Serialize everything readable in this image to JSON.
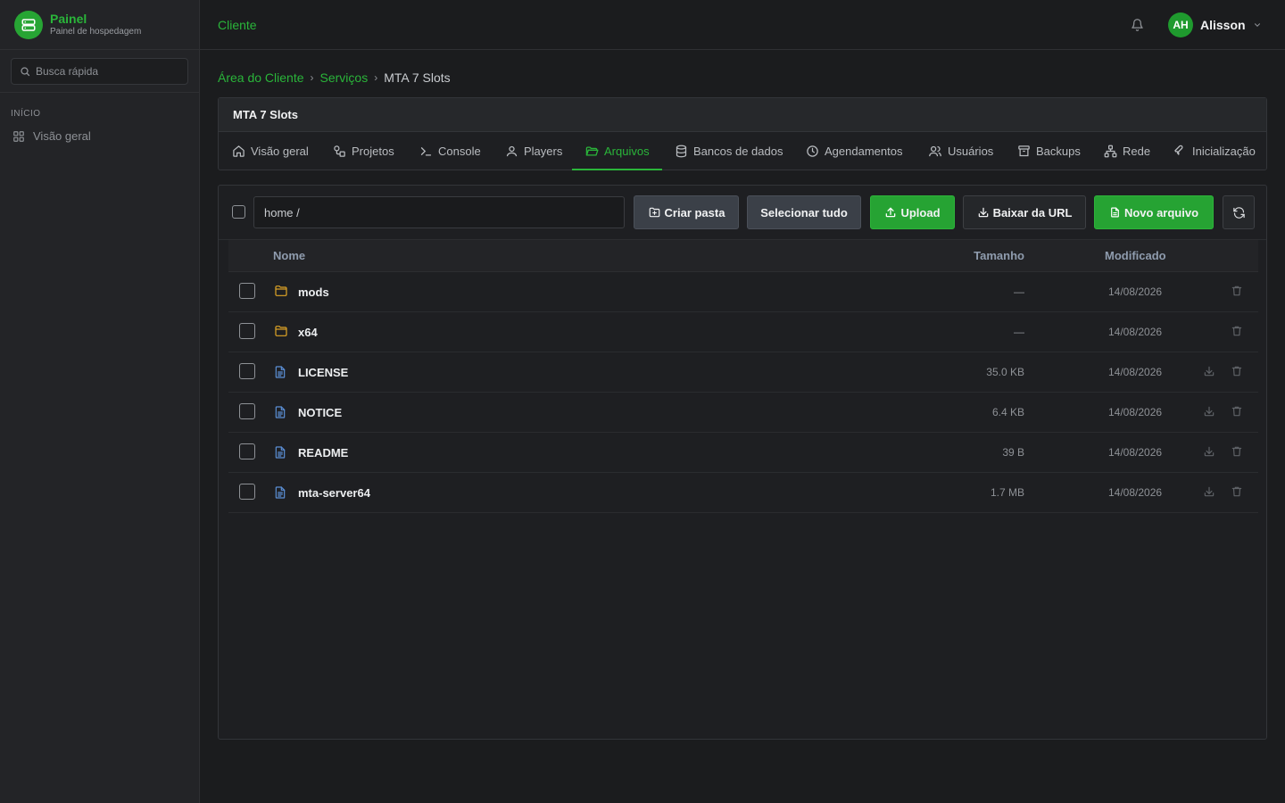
{
  "brand": {
    "title": "Painel",
    "subtitle": "Painel de hospedagem"
  },
  "sidebar": {
    "search_placeholder": "Busca rápida",
    "section_label": "INÍCIO",
    "items": [
      {
        "label": "Visão geral",
        "icon": "grid-icon"
      }
    ]
  },
  "header": {
    "title": "Cliente",
    "user": {
      "initials": "AH",
      "name": "Alisson"
    }
  },
  "breadcrumb": [
    {
      "label": "Área do Cliente"
    },
    {
      "label": "Serviços"
    },
    {
      "label": "MTA 7 Slots"
    }
  ],
  "service": {
    "title": "MTA 7 Slots",
    "tabs": [
      {
        "label": "Visão geral",
        "icon": "home-icon"
      },
      {
        "label": "Projetos",
        "icon": "projects-icon"
      },
      {
        "label": "Console",
        "icon": "terminal-icon"
      },
      {
        "label": "Players",
        "icon": "user-icon"
      },
      {
        "label": "Arquivos",
        "icon": "folder-open-icon",
        "active": true
      },
      {
        "label": "Bancos de dados",
        "icon": "database-icon"
      },
      {
        "label": "Agendamentos",
        "icon": "clock-icon"
      },
      {
        "label": "Usuários",
        "icon": "users-icon"
      },
      {
        "label": "Backups",
        "icon": "archive-icon"
      },
      {
        "label": "Rede",
        "icon": "network-icon"
      },
      {
        "label": "Inicialização",
        "icon": "wrench-icon"
      }
    ]
  },
  "files": {
    "path": "home /",
    "buttons": {
      "create_folder": "Criar pasta",
      "select_all": "Selecionar tudo",
      "upload": "Upload",
      "download_url": "Baixar da URL",
      "new_file": "Novo arquivo"
    },
    "columns": {
      "name": "Nome",
      "size": "Tamanho",
      "modified": "Modificado"
    },
    "rows": [
      {
        "name": "mods",
        "type": "folder",
        "size": "—",
        "modified": "14/08/2026"
      },
      {
        "name": "x64",
        "type": "folder",
        "size": "—",
        "modified": "14/08/2026"
      },
      {
        "name": "LICENSE",
        "type": "file",
        "size": "35.0 KB",
        "modified": "14/08/2026"
      },
      {
        "name": "NOTICE",
        "type": "file",
        "size": "6.4 KB",
        "modified": "14/08/2026"
      },
      {
        "name": "README",
        "type": "file",
        "size": "39 B",
        "modified": "14/08/2026"
      },
      {
        "name": "mta-server64",
        "type": "file",
        "size": "1.7 MB",
        "modified": "14/08/2026"
      }
    ]
  },
  "colors": {
    "accent": "#2ab53a",
    "folder": "#e0a526",
    "file": "#5b8fd6"
  }
}
